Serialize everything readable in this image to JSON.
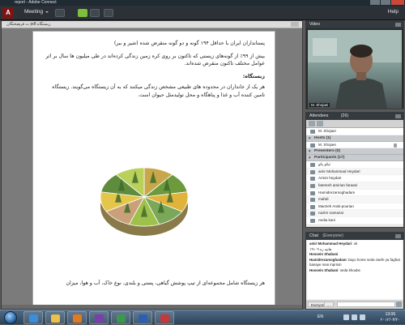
{
  "window": {
    "title": "report - Adobe Connect"
  },
  "menubar": {
    "meeting": "Meeting",
    "help": "Help"
  },
  "share": {
    "file_name": "ت فرهیختگان pdf.زیستگاه",
    "paragraphs": [
      "پستانداران ایران با حداقل ۱۹۴ گونه و دو گونه منقرض شده (شیر و ببر)",
      "بیش از ۹۹٪ از گونه‌های زیستی که تاکنون بر روی کره زمین زندگی کرده‌اند در طی میلیون ها سال بر اثر عوامل مختلف تاکنون منقرض شده‌اند.",
      "زیستگاه:",
      "هر یک از جانداران در محدوده های طبیعی مشخص زندگی میکنند که به آن زیستگاه می‌گویند. زیستگاه تامین کننده آب و غذا و پناهگاه و محل تولیدمثل حیوان است.",
      "هر زیستگاه شامل مجموعه‌ای از تیپ پوشش گیاهی، پستی و بلندی، نوع خاک، آب و هوا، میزان"
    ]
  },
  "video": {
    "title": "Video",
    "name": "M. Shojaei"
  },
  "attendees": {
    "title": "Attendees",
    "count": "(26)",
    "me": "M. Shojaei",
    "groups": [
      {
        "label": "Hosts (1)",
        "members": [
          "M. Shojaei"
        ]
      },
      {
        "label": "Presenters (0)",
        "members": []
      },
      {
        "label": "Participants (17)",
        "members": [
          "تیکو یکو",
          "amir Mohammad Heydari",
          "Armin heydari",
          "fatemeh amirian faraani",
          "Hamidrezamoghadam",
          "mahdi",
          "Marzieh Arab-pourian",
          "nazim namazai",
          "nedia kani"
        ]
      }
    ]
  },
  "chat": {
    "title": "Chat",
    "scope": "(Everyone)",
    "messages": [
      {
        "who": "amir Mohammad Heydari",
        "text": "ok"
      },
      {
        "who": "",
        "text": "۱۹۱۰۹ هانیه زه"
      },
      {
        "who": "Hossein Shabani",
        "text": ""
      },
      {
        "who": "Hamidrezamoghadam",
        "text": "bayo home seda zaefe ya faghat banaye man inprism"
      },
      {
        "who": "Hossein Shabani",
        "text": "seda khoube"
      }
    ],
    "tab_label": "Everyone",
    "tab2_label": "..."
  },
  "taskbar": {
    "lang": "EN",
    "time": "13:06",
    "date": "۲۰۱۲/۰۳/۲۰"
  },
  "chart_data": {
    "type": "pie",
    "title": "",
    "colors": [
      "#c7a74a",
      "#6c9a3c",
      "#e2b33a",
      "#7aa858",
      "#9fc04a",
      "#c9a07a",
      "#e4c74a",
      "#5f8b3d",
      "#b9d05a"
    ],
    "values": [
      1,
      1,
      1,
      1,
      1,
      1,
      1,
      1,
      1
    ]
  }
}
